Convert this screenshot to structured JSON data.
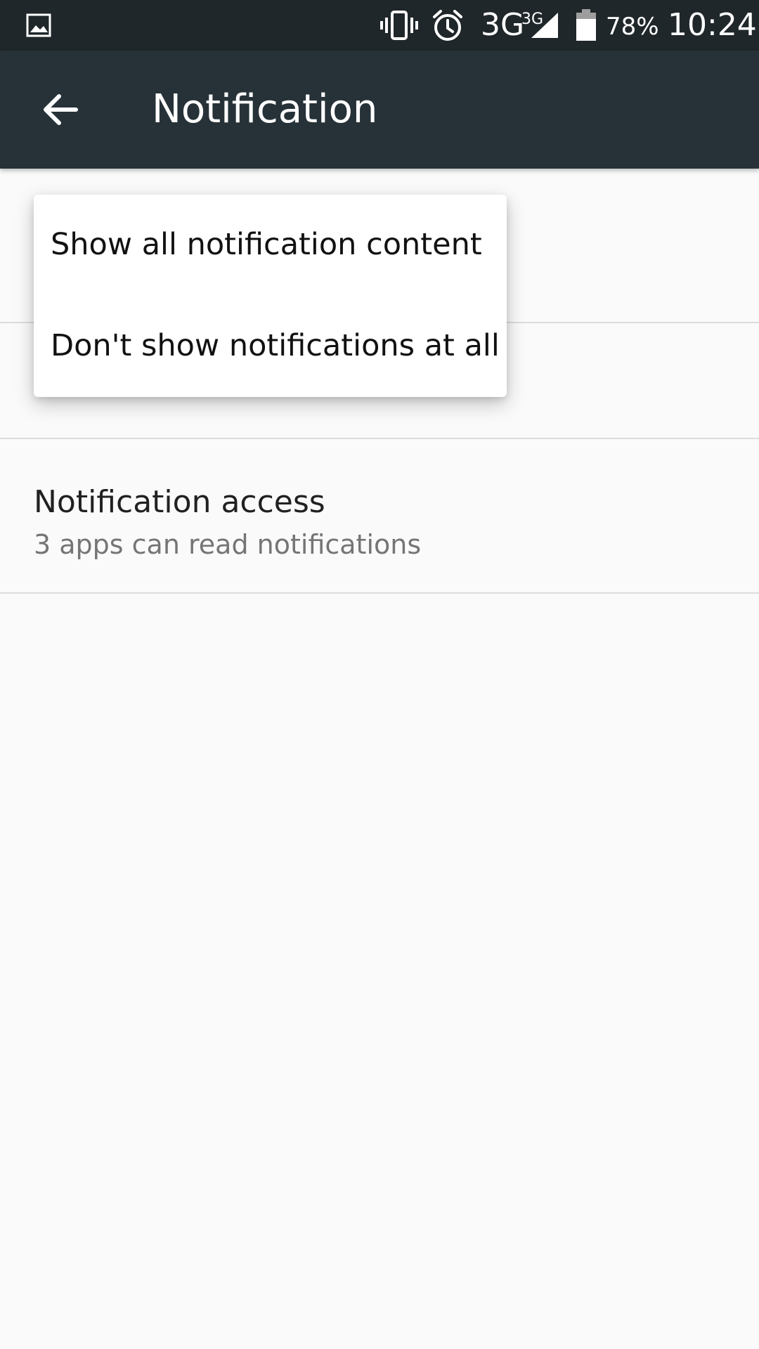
{
  "status_bar": {
    "battery_percent": "78%",
    "network": "3G",
    "network_superscript": "3G",
    "time": "10:24",
    "battery_level": 0.78,
    "icons": [
      "gallery-icon",
      "vibrate-icon",
      "alarm-icon",
      "signal-icon",
      "battery-icon"
    ]
  },
  "app_bar": {
    "title": "Notification",
    "back_icon": "arrow-back-icon"
  },
  "settings": {
    "notification_access": {
      "title": "Notification access",
      "summary": "3 apps can read notifications"
    }
  },
  "popup_menu": {
    "items": [
      {
        "label": "Show all notification content"
      },
      {
        "label": "Don't show notifications at all"
      }
    ]
  },
  "colors": {
    "status_bar": "#20272b",
    "app_bar": "#263238",
    "background": "#fafafa",
    "divider": "#dcdcdc"
  }
}
